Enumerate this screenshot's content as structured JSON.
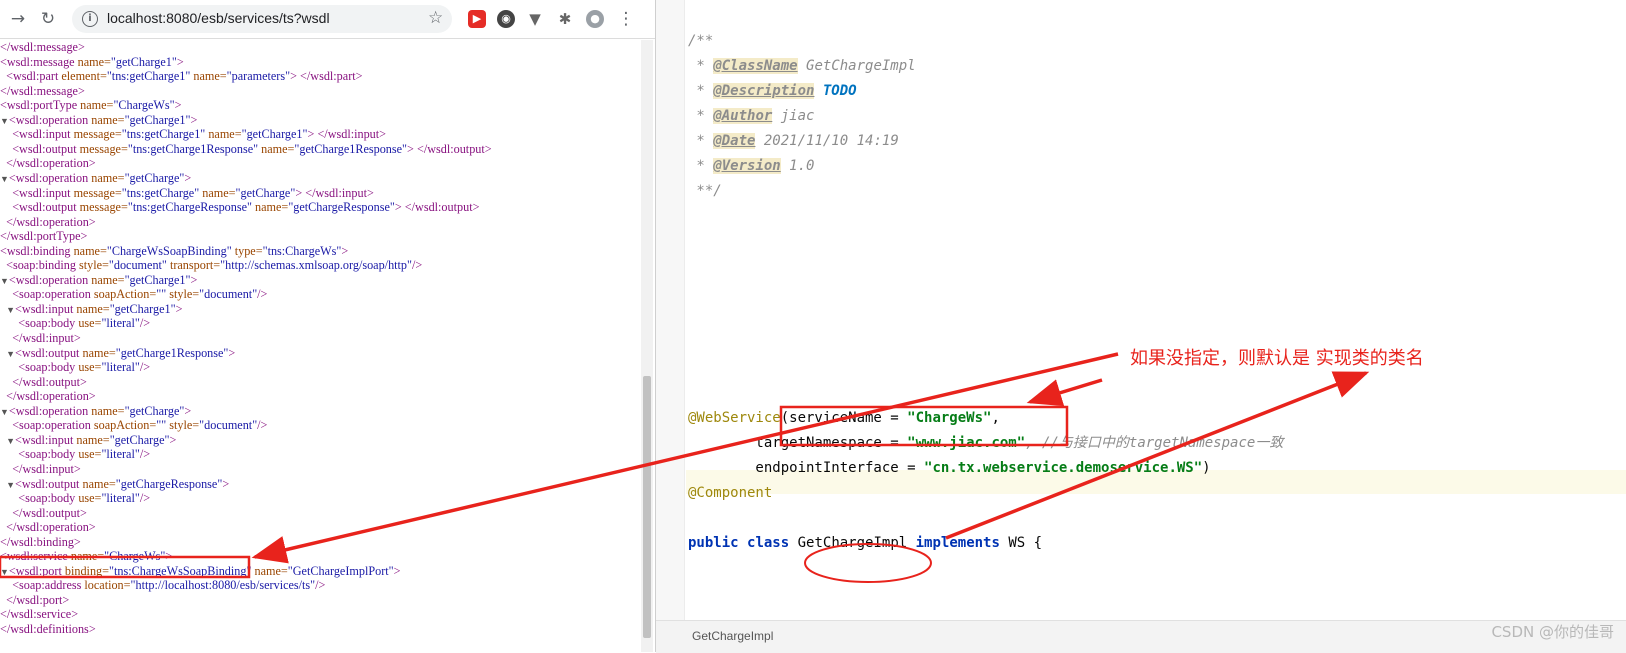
{
  "browser": {
    "url": "localhost:8080/esb/services/ts?wsdl",
    "back_glyph": "→",
    "reload_glyph": "↻",
    "menu_glyph": "⋮"
  },
  "xml_lines": [
    "</wsdl:message>",
    "<wsdl:message name=\"getCharge1\">",
    "  <wsdl:part element=\"tns:getCharge1\" name=\"parameters\"> </wsdl:part>",
    "</wsdl:message>",
    "<wsdl:portType name=\"ChargeWs\">",
    "▼<wsdl:operation name=\"getCharge1\">",
    "    <wsdl:input message=\"tns:getCharge1\" name=\"getCharge1\"> </wsdl:input>",
    "    <wsdl:output message=\"tns:getCharge1Response\" name=\"getCharge1Response\"> </wsdl:output>",
    "  </wsdl:operation>",
    "▼<wsdl:operation name=\"getCharge\">",
    "    <wsdl:input message=\"tns:getCharge\" name=\"getCharge\"> </wsdl:input>",
    "    <wsdl:output message=\"tns:getChargeResponse\" name=\"getChargeResponse\"> </wsdl:output>",
    "  </wsdl:operation>",
    "</wsdl:portType>",
    "<wsdl:binding name=\"ChargeWsSoapBinding\" type=\"tns:ChargeWs\">",
    "  <soap:binding style=\"document\" transport=\"http://schemas.xmlsoap.org/soap/http\"/>",
    "▼<wsdl:operation name=\"getCharge1\">",
    "    <soap:operation soapAction=\"\" style=\"document\"/>",
    "  ▼<wsdl:input name=\"getCharge1\">",
    "      <soap:body use=\"literal\"/>",
    "    </wsdl:input>",
    "  ▼<wsdl:output name=\"getCharge1Response\">",
    "      <soap:body use=\"literal\"/>",
    "    </wsdl:output>",
    "  </wsdl:operation>",
    "▼<wsdl:operation name=\"getCharge\">",
    "    <soap:operation soapAction=\"\" style=\"document\"/>",
    "  ▼<wsdl:input name=\"getCharge\">",
    "      <soap:body use=\"literal\"/>",
    "    </wsdl:input>",
    "  ▼<wsdl:output name=\"getChargeResponse\">",
    "      <soap:body use=\"literal\"/>",
    "    </wsdl:output>",
    "  </wsdl:operation>",
    "</wsdl:binding>",
    "<wsdl:service name=\"ChargeWs\">",
    "▼<wsdl:port binding=\"tns:ChargeWsSoapBinding\" name=\"GetChargeImplPort\">",
    "    <soap:address location=\"http://localhost:8080/esb/services/ts\"/>",
    "  </wsdl:port>",
    "</wsdl:service>",
    "</wsdl:definitions>"
  ],
  "code": {
    "doc_open": "/**",
    "doc_close": " **/",
    "doc_star": " * ",
    "tags": [
      {
        "tag": "@ClassName",
        "value": " GetChargeImpl"
      },
      {
        "tag": "@Description",
        "value": " TODO"
      },
      {
        "tag": "@Author",
        "value": " jiac"
      },
      {
        "tag": "@Date",
        "value": " 2021/11/10 14:19"
      },
      {
        "tag": "@Version",
        "value": " 1.0"
      }
    ],
    "webservice_annotation": "@WebService",
    "service_name_prefix": "(serviceName = ",
    "service_name_value": "\"ChargeWs\"",
    "service_name_suffix": ",",
    "target_ns_prefix": "        targetNamespace = ",
    "target_ns_value": "\"www.jiac.com\"",
    "target_ns_comment": ", //与接口中的targetNamespace一致",
    "endpoint_prefix": "        endpointInterface = ",
    "endpoint_value": "\"cn.tx.webservice.demoservice.WS\"",
    "endpoint_suffix": ")",
    "component_annotation": "@Component",
    "kw_public": "public",
    "kw_class": "class",
    "class_name": "GetChargeImpl",
    "kw_implements": "implements",
    "interface_name": "WS",
    "open_brace": " {"
  },
  "ide_breadcrumb": "GetChargeImpl",
  "annotation_text": "如果没指定，则默认是 实现类的类名",
  "watermark": "CSDN @你的佳哥",
  "colors": {
    "annotation_red": "#e8231c"
  }
}
